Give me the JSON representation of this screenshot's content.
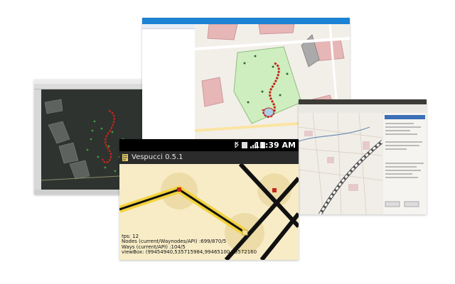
{
  "screens": {
    "josm": {
      "name": "josm-screenshot"
    },
    "browser": {
      "name": "id-editor-screenshot"
    },
    "merkaartor": {
      "name": "merkaartor-screenshot"
    },
    "vespucci": {
      "app_title": "Vespucci 0.5.1",
      "clock": "11:39 AM",
      "status_icons": [
        "bluetooth-icon",
        "data-icon",
        "signal-icon",
        "alarm-icon"
      ],
      "overlay": {
        "fps": "fps: 12",
        "nodes": "Nodes (current/Waynodes/API) :699/870/5",
        "ways": "Ways (current/API) :104/5",
        "viewbox": "viewBox: (99454940,535715984,99465100,53572160"
      }
    }
  },
  "colors": {
    "path_red": "#c0261b",
    "highlight_yellow": "#f2d33b",
    "josm_bg": "#2e332f",
    "id_topbar": "#1b82d4",
    "phone_bg": "#f7ecc6"
  }
}
